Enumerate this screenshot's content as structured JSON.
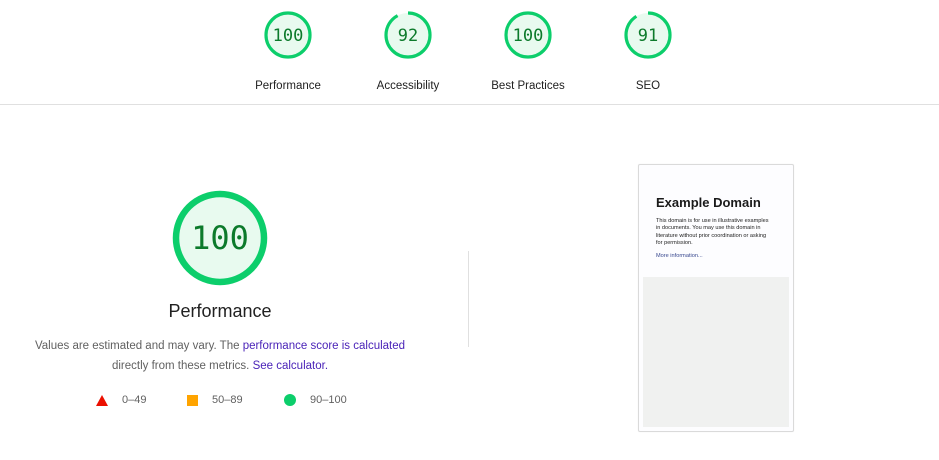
{
  "colors": {
    "pass": "#0cce6b",
    "pass_bg": "#e8faef",
    "pass_text": "#0c7a2b",
    "average": "#ffa400",
    "fail": "#eb0f00",
    "link": "#4a23b8"
  },
  "categories": [
    {
      "score": 100,
      "label": "Performance"
    },
    {
      "score": 92,
      "label": "Accessibility"
    },
    {
      "score": 100,
      "label": "Best Practices"
    },
    {
      "score": 91,
      "label": "SEO"
    }
  ],
  "performance": {
    "score": 100,
    "title": "Performance",
    "desc_prefix": "Values are estimated and may vary. The ",
    "desc_link": "performance score is calculated",
    "desc_middle": "directly from these metrics. ",
    "calc_link": "See calculator."
  },
  "legend": [
    {
      "icon": "fail-triangle-icon",
      "range": "0–49"
    },
    {
      "icon": "average-square-icon",
      "range": "50–89"
    },
    {
      "icon": "pass-circle-icon",
      "range": "90–100"
    }
  ],
  "screenshot": {
    "title": "Example Domain",
    "body": "This domain is for use in illustrative examples in documents. You may use this domain in literature without prior coordination or asking for permission.",
    "link": "More information..."
  }
}
